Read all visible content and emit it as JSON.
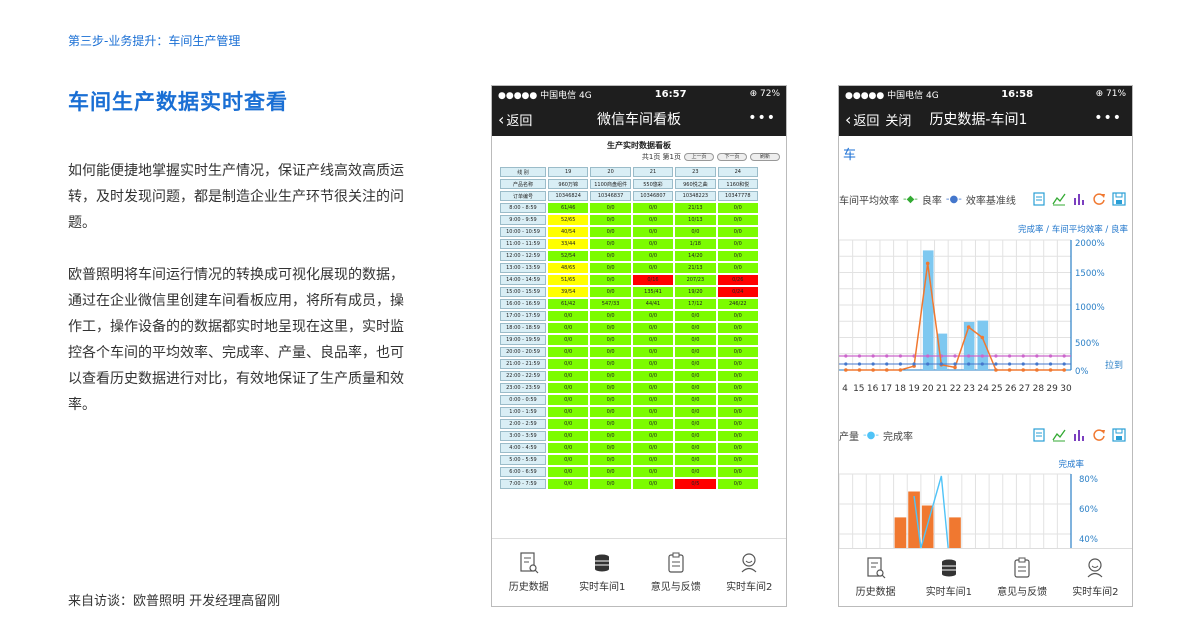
{
  "left": {
    "step": "第三步-业务提升：车间生产管理",
    "headline": "车间生产数据实时查看",
    "para1": "如何能便捷地掌握实时生产情况，保证产线高效高质运转，及时发现问题，都是制造企业生产环节很关注的问题。",
    "para2": "欧普照明将车间运行情况的转换成可视化展现的数据，通过在企业微信里创建车间看板应用，将所有成员，操作工，操作设备的的数据都实时地呈现在这里，实时监控各个车间的平均效率、完成率、产量、良品率，也可以查看历史数据进行对比，有效地保证了生产质量和效率。",
    "source": "来自访谈：欧普照明 开发经理高留刚"
  },
  "phone1": {
    "status": {
      "carrier": "●●●●● 中国电信  4G",
      "time": "16:57",
      "battery": "⊕ 72%"
    },
    "back_label": "返回",
    "title": "微信车间看板",
    "more": "•••",
    "board_title": "生产实时数据看板",
    "pager_text": "共1页  第1页",
    "pager_buttons": [
      "上一页",
      "下一页",
      "刷新"
    ],
    "header_rows": [
      {
        "label": "线 别",
        "cells": [
          "19",
          "20",
          "21",
          "23",
          "24"
        ]
      },
      {
        "label": "产品名称",
        "cells": [
          "960万锦",
          "1100商盘组件",
          "550悠彩",
          "960悦之曲",
          "1160和悦"
        ]
      },
      {
        "label": "订单编号",
        "cells": [
          "10346824",
          "10346837",
          "10346807",
          "10348223",
          "10347778"
        ]
      }
    ],
    "rows": [
      {
        "time": "8:00 - 8:59",
        "cells": [
          [
            "61/46",
            "g"
          ],
          [
            "0/0",
            "g"
          ],
          [
            "0/0",
            "g"
          ],
          [
            "21/13",
            "g"
          ],
          [
            "0/0",
            "g"
          ]
        ]
      },
      {
        "time": "9:00 - 9:59",
        "cells": [
          [
            "52/65",
            "y"
          ],
          [
            "0/0",
            "g"
          ],
          [
            "0/0",
            "g"
          ],
          [
            "10/13",
            "g"
          ],
          [
            "0/0",
            "g"
          ]
        ]
      },
      {
        "time": "10:00 - 10:59",
        "cells": [
          [
            "40/54",
            "y"
          ],
          [
            "0/0",
            "g"
          ],
          [
            "0/0",
            "g"
          ],
          [
            "0/0",
            "g"
          ],
          [
            "0/0",
            "g"
          ]
        ]
      },
      {
        "time": "11:00 - 11:59",
        "cells": [
          [
            "33/44",
            "y"
          ],
          [
            "0/0",
            "g"
          ],
          [
            "0/0",
            "g"
          ],
          [
            "1/18",
            "g"
          ],
          [
            "0/0",
            "g"
          ]
        ]
      },
      {
        "time": "12:00 - 12:59",
        "cells": [
          [
            "52/54",
            "g"
          ],
          [
            "0/0",
            "g"
          ],
          [
            "0/0",
            "g"
          ],
          [
            "14/20",
            "g"
          ],
          [
            "0/0",
            "g"
          ]
        ]
      },
      {
        "time": "13:00 - 13:59",
        "cells": [
          [
            "48/65",
            "y"
          ],
          [
            "0/0",
            "g"
          ],
          [
            "0/0",
            "g"
          ],
          [
            "21/13",
            "g"
          ],
          [
            "0/0",
            "g"
          ]
        ]
      },
      {
        "time": "14:00 - 14:59",
        "cells": [
          [
            "51/65",
            "y"
          ],
          [
            "0/0",
            "g"
          ],
          [
            "0/16",
            "r"
          ],
          [
            "207/23",
            "g"
          ],
          [
            "0/26",
            "r"
          ]
        ]
      },
      {
        "time": "15:00 - 15:59",
        "cells": [
          [
            "39/54",
            "y"
          ],
          [
            "0/0",
            "g"
          ],
          [
            "135/41",
            "g"
          ],
          [
            "19/20",
            "g"
          ],
          [
            "0/24",
            "r"
          ]
        ]
      },
      {
        "time": "16:00 - 16:59",
        "cells": [
          [
            "61/42",
            "g"
          ],
          [
            "547/33",
            "g"
          ],
          [
            "44/41",
            "g"
          ],
          [
            "17/12",
            "g"
          ],
          [
            "246/22",
            "g"
          ]
        ]
      },
      {
        "time": "17:00 - 17:59",
        "cells": [
          [
            "0/0",
            "g"
          ],
          [
            "0/0",
            "g"
          ],
          [
            "0/0",
            "g"
          ],
          [
            "0/0",
            "g"
          ],
          [
            "0/0",
            "g"
          ]
        ]
      },
      {
        "time": "18:00 - 18:59",
        "cells": [
          [
            "0/0",
            "g"
          ],
          [
            "0/0",
            "g"
          ],
          [
            "0/0",
            "g"
          ],
          [
            "0/0",
            "g"
          ],
          [
            "0/0",
            "g"
          ]
        ]
      },
      {
        "time": "19:00 - 19:59",
        "cells": [
          [
            "0/0",
            "g"
          ],
          [
            "0/0",
            "g"
          ],
          [
            "0/0",
            "g"
          ],
          [
            "0/0",
            "g"
          ],
          [
            "0/0",
            "g"
          ]
        ]
      },
      {
        "time": "20:00 - 20:59",
        "cells": [
          [
            "0/0",
            "g"
          ],
          [
            "0/0",
            "g"
          ],
          [
            "0/0",
            "g"
          ],
          [
            "0/0",
            "g"
          ],
          [
            "0/0",
            "g"
          ]
        ]
      },
      {
        "time": "21:00 - 21:59",
        "cells": [
          [
            "0/0",
            "g"
          ],
          [
            "0/0",
            "g"
          ],
          [
            "0/0",
            "g"
          ],
          [
            "0/0",
            "g"
          ],
          [
            "0/0",
            "g"
          ]
        ]
      },
      {
        "time": "22:00 - 22:59",
        "cells": [
          [
            "0/0",
            "g"
          ],
          [
            "0/0",
            "g"
          ],
          [
            "0/0",
            "g"
          ],
          [
            "0/0",
            "g"
          ],
          [
            "0/0",
            "g"
          ]
        ]
      },
      {
        "time": "23:00 - 23:59",
        "cells": [
          [
            "0/0",
            "g"
          ],
          [
            "0/0",
            "g"
          ],
          [
            "0/0",
            "g"
          ],
          [
            "0/0",
            "g"
          ],
          [
            "0/0",
            "g"
          ]
        ]
      },
      {
        "time": "0:00 - 0:59",
        "cells": [
          [
            "0/0",
            "g"
          ],
          [
            "0/0",
            "g"
          ],
          [
            "0/0",
            "g"
          ],
          [
            "0/0",
            "g"
          ],
          [
            "0/0",
            "g"
          ]
        ]
      },
      {
        "time": "1:00 - 1:59",
        "cells": [
          [
            "0/0",
            "g"
          ],
          [
            "0/0",
            "g"
          ],
          [
            "0/0",
            "g"
          ],
          [
            "0/0",
            "g"
          ],
          [
            "0/0",
            "g"
          ]
        ]
      },
      {
        "time": "2:00 - 2:59",
        "cells": [
          [
            "0/0",
            "g"
          ],
          [
            "0/0",
            "g"
          ],
          [
            "0/0",
            "g"
          ],
          [
            "0/0",
            "g"
          ],
          [
            "0/0",
            "g"
          ]
        ]
      },
      {
        "time": "3:00 - 3:59",
        "cells": [
          [
            "0/0",
            "g"
          ],
          [
            "0/0",
            "g"
          ],
          [
            "0/0",
            "g"
          ],
          [
            "0/0",
            "g"
          ],
          [
            "0/0",
            "g"
          ]
        ]
      },
      {
        "time": "4:00 - 4:59",
        "cells": [
          [
            "0/0",
            "g"
          ],
          [
            "0/0",
            "g"
          ],
          [
            "0/0",
            "g"
          ],
          [
            "0/0",
            "g"
          ],
          [
            "0/0",
            "g"
          ]
        ]
      },
      {
        "time": "5:00 - 5:59",
        "cells": [
          [
            "0/0",
            "g"
          ],
          [
            "0/0",
            "g"
          ],
          [
            "0/0",
            "g"
          ],
          [
            "0/0",
            "g"
          ],
          [
            "0/0",
            "g"
          ]
        ]
      },
      {
        "time": "6:00 - 6:59",
        "cells": [
          [
            "0/0",
            "g"
          ],
          [
            "0/0",
            "g"
          ],
          [
            "0/0",
            "g"
          ],
          [
            "0/0",
            "g"
          ],
          [
            "0/0",
            "g"
          ]
        ]
      },
      {
        "time": "7:00 - 7:59",
        "cells": [
          [
            "0/0",
            "g"
          ],
          [
            "0/0",
            "g"
          ],
          [
            "0/0",
            "g"
          ],
          [
            "0/5",
            "r"
          ],
          [
            "0/0",
            "g"
          ]
        ]
      }
    ],
    "tabs": [
      "历史数据",
      "实时车间1",
      "意见与反馈",
      "实时车间2"
    ]
  },
  "phone2": {
    "status": {
      "carrier": "●●●●● 中国电信  4G",
      "time": "16:58",
      "battery": "⊕ 71%"
    },
    "back_label": "返回",
    "close_label": "关闭",
    "title": "历史数据-车间1",
    "more": "•••",
    "subhead": "车",
    "chart1": {
      "legend": [
        "车间平均效率",
        "良率",
        "效率基准线"
      ],
      "axis_title": "完成率 / 车间平均效率 / 良率",
      "y_ticks": [
        "2000%",
        "1500%",
        "1000%",
        "500%",
        "0%"
      ],
      "x_ticks": [
        "4",
        "15",
        "16",
        "17",
        "18",
        "19",
        "20",
        "21",
        "22",
        "23",
        "24",
        "25",
        "26",
        "27",
        "28",
        "29",
        "30"
      ],
      "drag_label": "拉到"
    },
    "chart2": {
      "legend": [
        "产量",
        "完成率"
      ],
      "axis_title": "完成率",
      "y_ticks": [
        "80%",
        "60%",
        "40%"
      ]
    },
    "tabs": [
      "历史数据",
      "实时车间1",
      "意见与反馈",
      "实时车间2"
    ],
    "colors": {
      "bar_blue": "#7ec8f0",
      "line_orange": "#f07830",
      "line_green": "#33aa33",
      "baseline_purple": "#cc66cc",
      "bar_orange": "#f07830",
      "line_blue": "#4fc3f7"
    }
  }
}
